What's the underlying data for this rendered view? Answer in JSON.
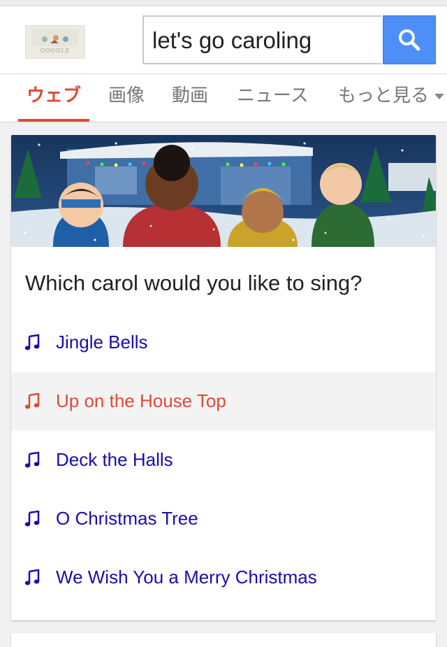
{
  "search": {
    "query": "let's go caroling"
  },
  "logo": {
    "text": "GOOGLE"
  },
  "tabs": [
    {
      "label": "ウェブ"
    },
    {
      "label": "画像"
    },
    {
      "label": "動画"
    },
    {
      "label": "ニュース"
    },
    {
      "label": "もっと見る"
    }
  ],
  "card": {
    "question": "Which carol would you like to sing?",
    "songs": [
      {
        "title": "Jingle Bells"
      },
      {
        "title": "Up on the House Top"
      },
      {
        "title": "Deck the Halls"
      },
      {
        "title": "O Christmas Tree"
      },
      {
        "title": "We Wish You a Merry Christmas"
      }
    ],
    "selected_index": 1
  },
  "icons": {
    "search": "search-icon",
    "note": "music-note-icon",
    "more_caret": "caret-down-icon"
  },
  "colors": {
    "accent_red": "#dd4b39",
    "link_blue": "#1a0dab",
    "search_button": "#4d8ff6"
  }
}
